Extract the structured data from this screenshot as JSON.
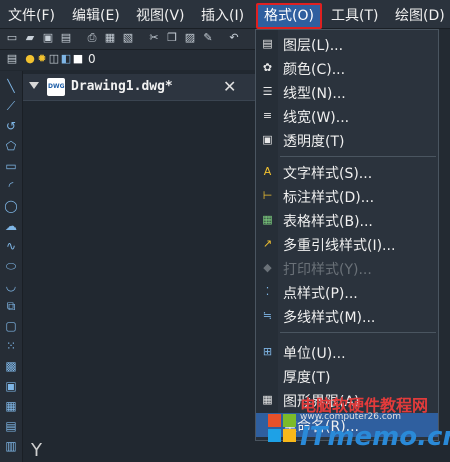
{
  "menubar": {
    "items": [
      {
        "label": "文件(F)"
      },
      {
        "label": "编辑(E)"
      },
      {
        "label": "视图(V)"
      },
      {
        "label": "插入(I)"
      },
      {
        "label": "格式(O)"
      },
      {
        "label": "工具(T)"
      },
      {
        "label": "绘图(D)"
      }
    ]
  },
  "toolbar2": {
    "layer_value": "0"
  },
  "tab": {
    "title": "Drawing1.dwg*",
    "icon_text": "DWG",
    "close": "✕"
  },
  "canvas": {
    "ucs_label": "Y"
  },
  "format_menu": {
    "items": [
      {
        "label": "图层(L)...",
        "icon": "layers-icon"
      },
      {
        "label": "颜色(C)...",
        "icon": "palette-icon"
      },
      {
        "label": "线型(N)...",
        "icon": "linetype-icon"
      },
      {
        "label": "线宽(W)...",
        "icon": "lineweight-icon"
      },
      {
        "label": "透明度(T)",
        "icon": "transparency-icon"
      },
      {
        "label": "文字样式(S)...",
        "icon": "text-style-icon"
      },
      {
        "label": "标注样式(D)...",
        "icon": "dim-style-icon"
      },
      {
        "label": "表格样式(B)...",
        "icon": "table-style-icon"
      },
      {
        "label": "多重引线样式(I)...",
        "icon": "mleader-style-icon"
      },
      {
        "label": "打印样式(Y)...",
        "icon": "plot-style-icon",
        "disabled": true
      },
      {
        "label": "点样式(P)...",
        "icon": "point-style-icon"
      },
      {
        "label": "多线样式(M)...",
        "icon": "mline-style-icon"
      },
      {
        "label": "单位(U)...",
        "icon": "units-icon"
      },
      {
        "label": "厚度(T)",
        "icon": "thickness-icon"
      },
      {
        "label": "图形界限(A)",
        "icon": "limits-icon"
      },
      {
        "label": "重命名(R)...",
        "icon": "rename-icon"
      }
    ]
  },
  "watermark": {
    "line1": "电脑软硬件教程网",
    "line2": "www.computer26.com",
    "line3": "ITmemo.cn"
  },
  "colors": {
    "active_outline": "#e02020",
    "highlight": "#2f5f9f",
    "background": "#212830"
  }
}
